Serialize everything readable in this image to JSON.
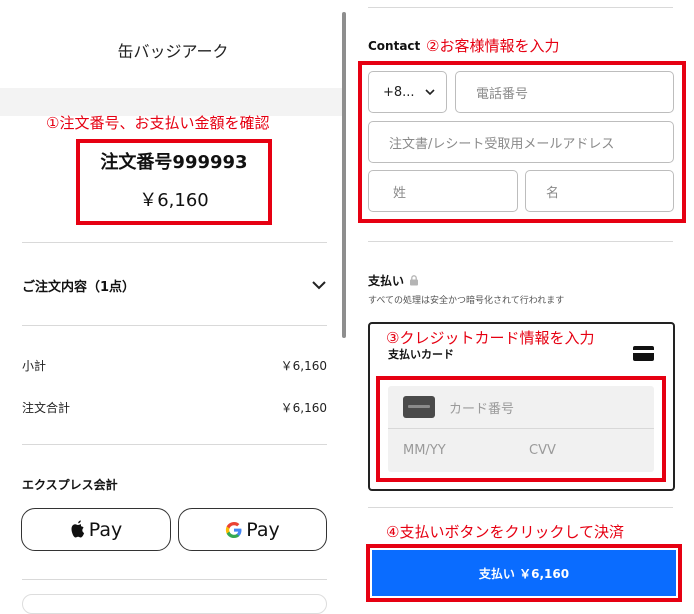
{
  "store": {
    "title": "缶バッジアーク"
  },
  "annotations": {
    "step1": "①注文番号、お支払い金額を確認",
    "step2": "②お客様情報を入力",
    "step3": "③クレジットカード情報を入力",
    "step4": "④支払いボタンをクリックして決済"
  },
  "order": {
    "number": "注文番号999993",
    "amount": "￥6,160",
    "contents_label": "ご注文内容（1点）",
    "subtotal_label": "小計",
    "subtotal_value": "￥6,160",
    "total_label": "注文合計",
    "total_value": "￥6,160"
  },
  "express": {
    "label": "エクスプレス会計",
    "apple_pay": "Pay",
    "google_pay": "Pay"
  },
  "contact": {
    "label": "Contact",
    "country_code": "+8...",
    "phone_placeholder": "電話番号",
    "email_placeholder": "注文書/レシート受取用メールアドレス",
    "last_name_placeholder": "姓",
    "first_name_placeholder": "名"
  },
  "payment": {
    "label": "支払い",
    "note": "すべての処理は安全かつ暗号化されて行われます",
    "card_title": "支払いカード",
    "card_number_placeholder": "カード番号",
    "expiry_placeholder": "MM/YY",
    "cvv_placeholder": "CVV",
    "submit_label": "支払い ￥6,160"
  },
  "colors": {
    "annotation_red": "#e60012",
    "pay_button_blue": "#0a6cff"
  }
}
